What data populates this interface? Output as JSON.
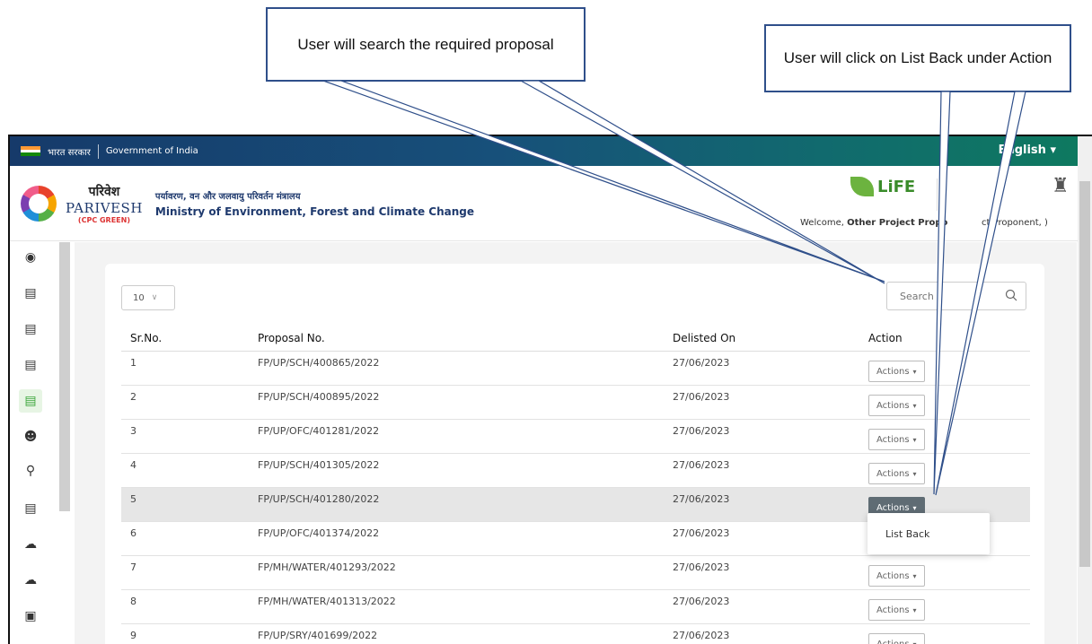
{
  "callouts": {
    "search": "User will search the required proposal",
    "listback": "User will click on List Back under Action"
  },
  "gov": {
    "hindi": "भारत सरकार",
    "english": "Government of India",
    "language": "English"
  },
  "brand": {
    "hindi": "परिवेश",
    "name": "PARIVESH",
    "sub": "(CPC GREEN)",
    "ministry_hindi": "पर्यावरण, वन और जलवायु परिवर्तन मंत्रालय",
    "ministry_english": "Ministry of Environment, Forest and Climate Change",
    "life_logo": "LiFE"
  },
  "user": {
    "welcome_prefix": "Welcome,",
    "name": "Other Project Propo",
    "role": "ct Proponent, )"
  },
  "table": {
    "page_size": "10",
    "search_placeholder": "Search",
    "headers": {
      "sr": "Sr.No.",
      "proposal": "Proposal No.",
      "delisted": "Delisted On",
      "action": "Action"
    },
    "action_label": "Actions",
    "rows": [
      {
        "sr": "1",
        "proposal": "FP/UP/SCH/400865/2022",
        "date": "27/06/2023"
      },
      {
        "sr": "2",
        "proposal": "FP/UP/SCH/400895/2022",
        "date": "27/06/2023"
      },
      {
        "sr": "3",
        "proposal": "FP/UP/OFC/401281/2022",
        "date": "27/06/2023"
      },
      {
        "sr": "4",
        "proposal": "FP/UP/SCH/401305/2022",
        "date": "27/06/2023"
      },
      {
        "sr": "5",
        "proposal": "FP/UP/SCH/401280/2022",
        "date": "27/06/2023"
      },
      {
        "sr": "6",
        "proposal": "FP/UP/OFC/401374/2022",
        "date": "27/06/2023"
      },
      {
        "sr": "7",
        "proposal": "FP/MH/WATER/401293/2022",
        "date": "27/06/2023"
      },
      {
        "sr": "8",
        "proposal": "FP/MH/WATER/401313/2022",
        "date": "27/06/2023"
      },
      {
        "sr": "9",
        "proposal": "FP/UP/SRY/401699/2022",
        "date": "27/06/2023"
      }
    ]
  },
  "dropdown": {
    "item": "List Back"
  }
}
